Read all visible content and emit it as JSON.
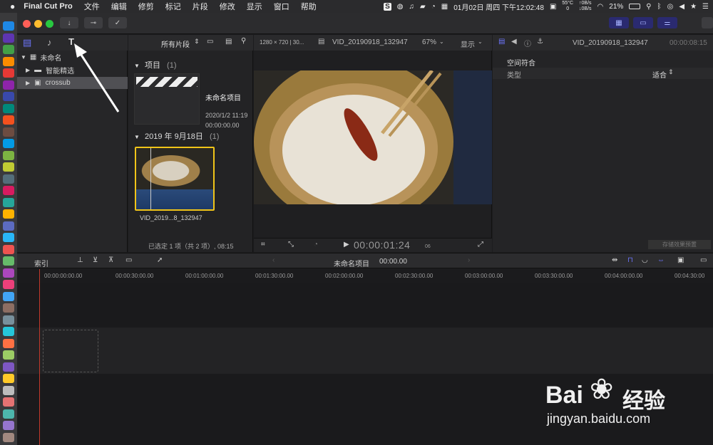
{
  "menubar": {
    "app_name": "Final Cut Pro",
    "items": [
      "文件",
      "编辑",
      "修剪",
      "标记",
      "片段",
      "修改",
      "显示",
      "窗口",
      "帮助"
    ],
    "clock": "01月02日 周四 下午12:02:48",
    "battery": "21%",
    "temp": "55°C",
    "temp_sub": "0",
    "net_up": "↑0B/s",
    "net_down": "↓0B/s"
  },
  "library": {
    "root_label": "未命名",
    "items": [
      {
        "label": "智能精选"
      },
      {
        "label": "crossub"
      }
    ]
  },
  "browser": {
    "filter_label": "所有片段",
    "projects_header": "项目",
    "projects_count": "(1)",
    "project_name": "未命名项目",
    "project_date": "2020/1/2 11:19",
    "project_duration": "00:00:00.00",
    "event_header": "2019 年 9月18日",
    "event_count": "(1)",
    "clip_name": "VID_2019...8_132947",
    "selection_status": "已选定 1 项（共 2 项）, 08:15"
  },
  "viewer": {
    "format": "1280 × 720 | 30...",
    "clip_title": "VID_20190918_132947",
    "zoom": "67%",
    "display_menu": "显示",
    "timecode": "00:00:01:24",
    "timecode_frames": "06"
  },
  "inspector": {
    "clip_title": "VID_20190918_132947",
    "duration": "00:00:08:15",
    "section": "空间符合",
    "type_label": "类型",
    "type_value": "适合",
    "save_preset": "存储效果预置"
  },
  "timeline": {
    "index_label": "索引",
    "project_name": "未命名项目",
    "project_time": "00:00.00",
    "ruler_ticks": [
      "00:00:00:00.00",
      "00:00:30:00.00",
      "00:01:00:00.00",
      "00:01:30:00.00",
      "00:02:00:00.00",
      "00:02:30:00.00",
      "00:03:00:00.00",
      "00:03:30:00.00",
      "00:04:00:00.00",
      "00:04:30:00"
    ]
  },
  "watermark": {
    "brand_left": "Bai",
    "brand_right": "经验",
    "url": "jingyan.baidu.com"
  },
  "colors": {
    "accent_blue": "#6e76ff",
    "selection_yellow": "#f0c419",
    "playhead_red": "#c0392b"
  }
}
